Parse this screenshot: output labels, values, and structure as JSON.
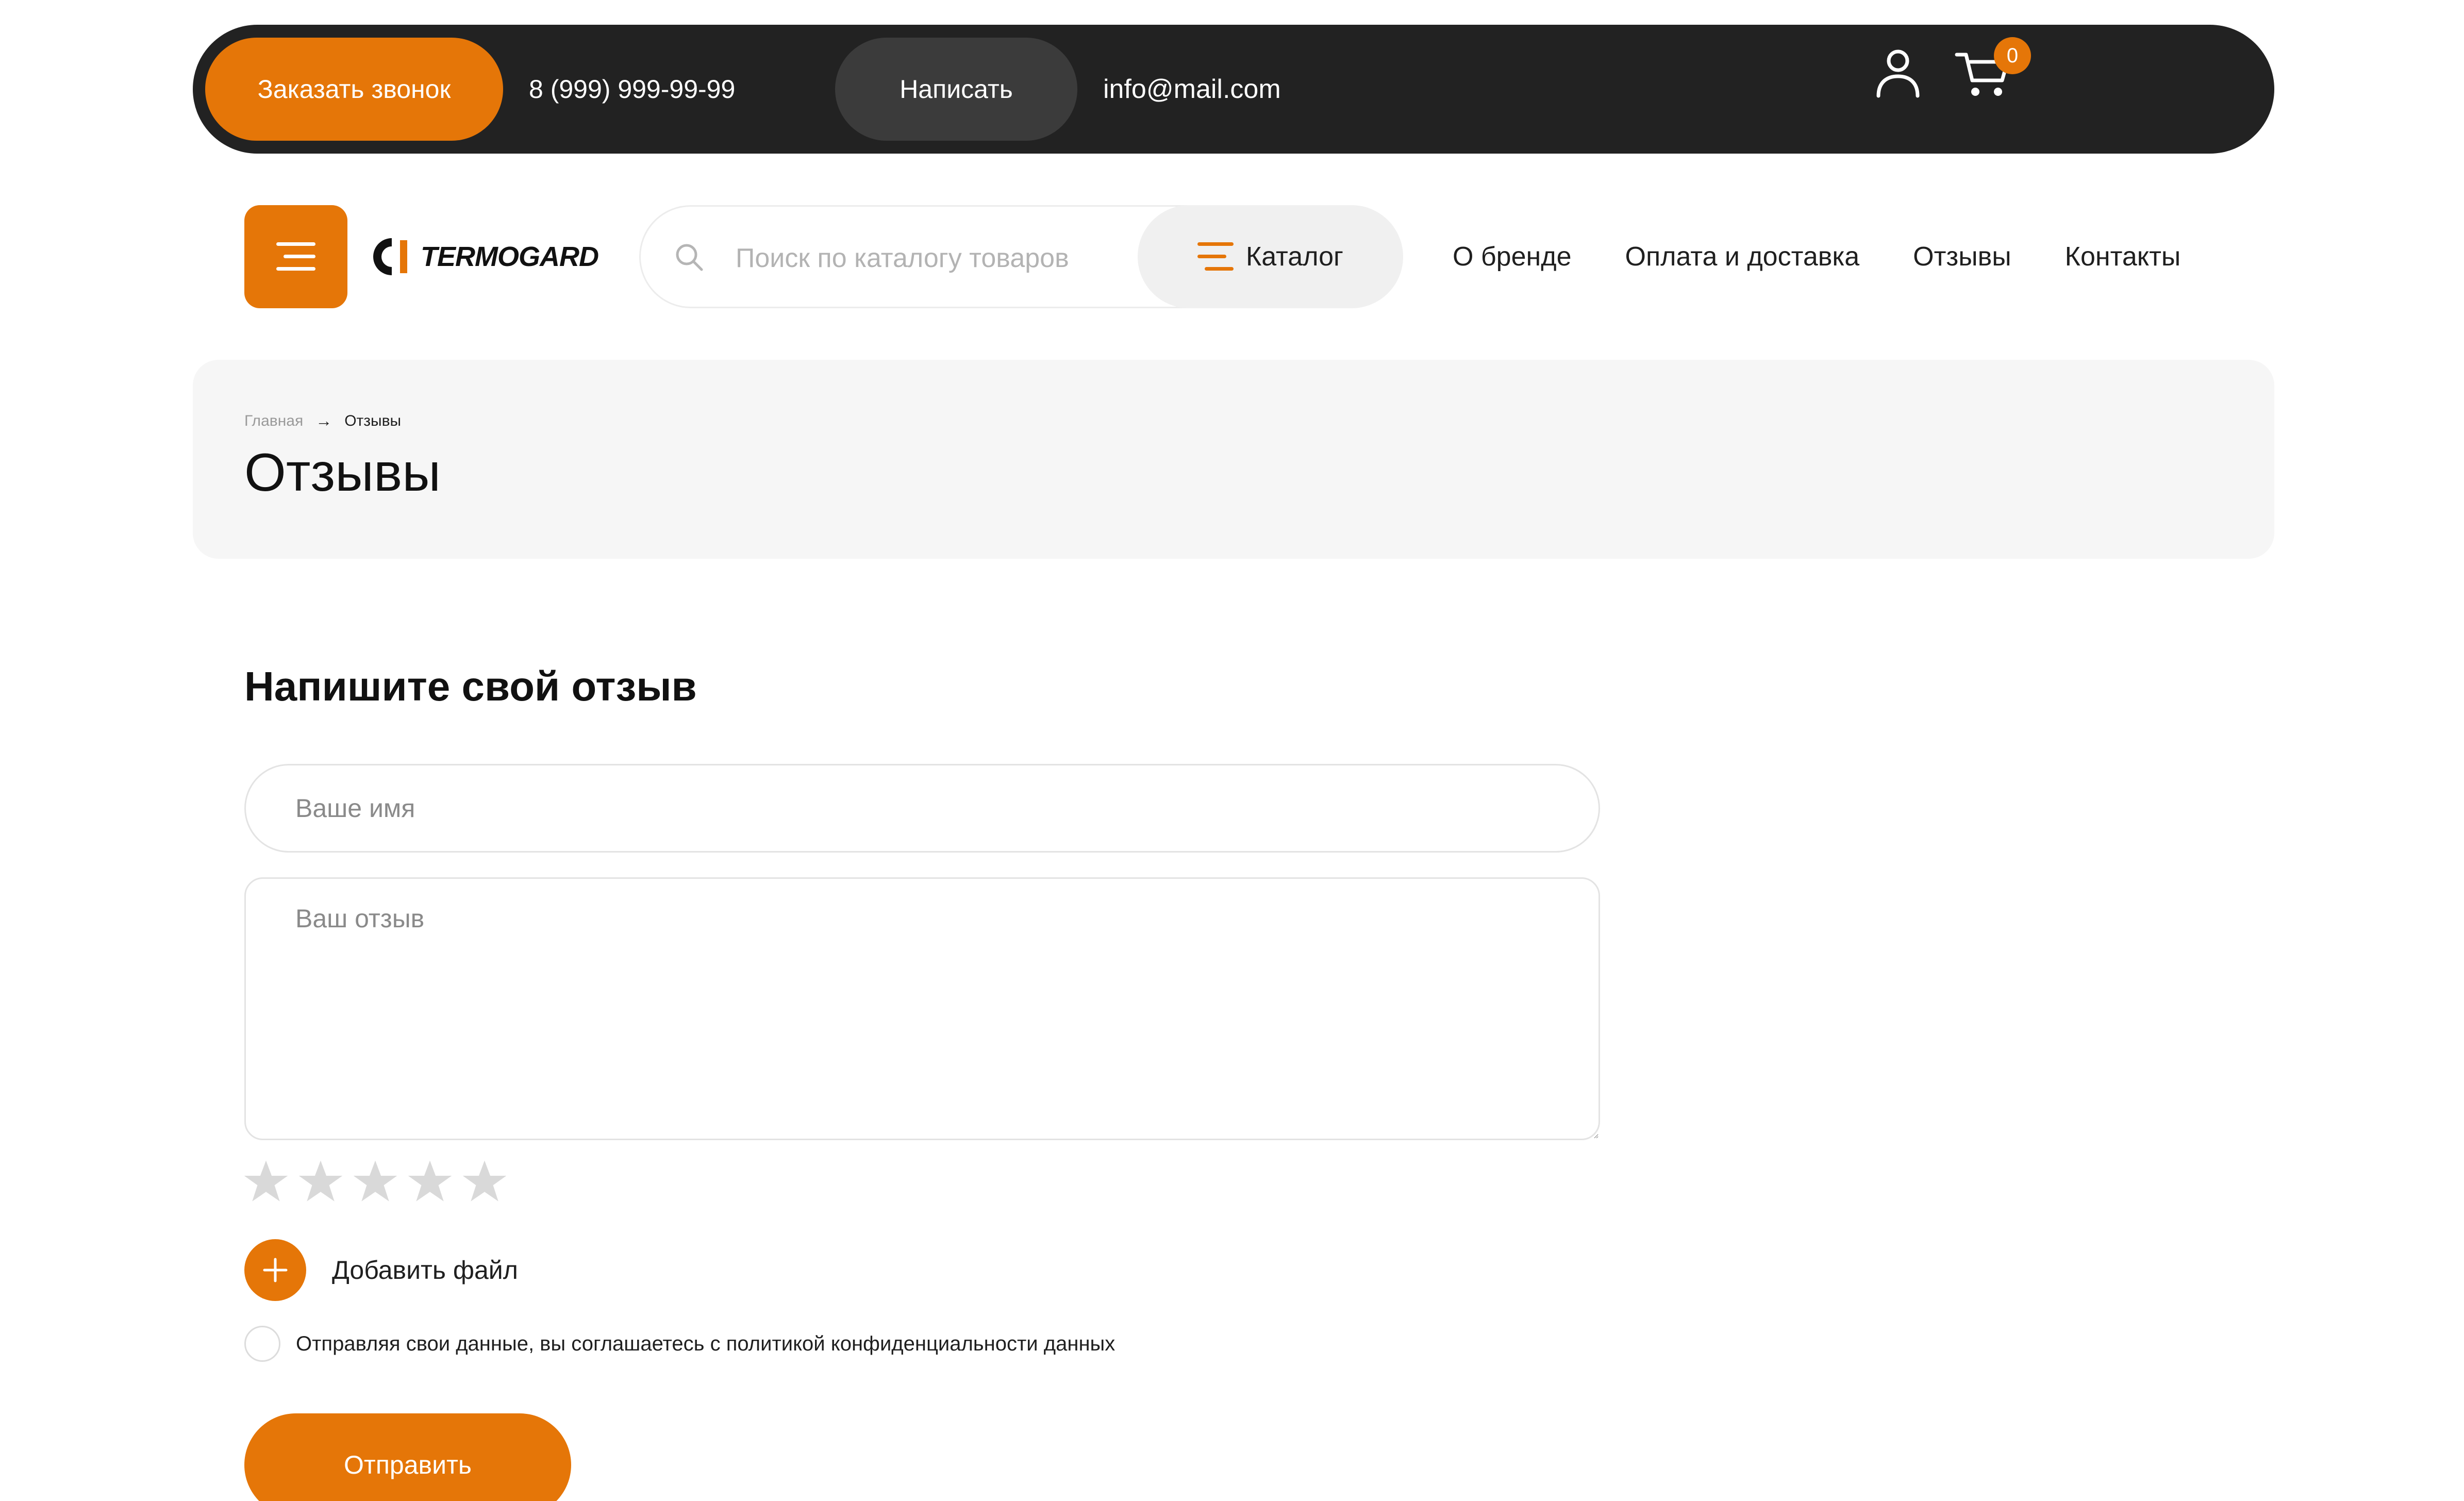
{
  "topbar": {
    "call_button": "Заказать звонок",
    "phone": "8 (999) 999-99-99",
    "write_button": "Написать",
    "email": "info@mail.com",
    "cart_count": "0"
  },
  "header": {
    "logo_text": "TERMOGARD",
    "search_placeholder": "Поиск по каталогу товаров",
    "catalog_label": "Каталог",
    "nav": [
      "О бренде",
      "Оплата и доставка",
      "Отзывы",
      "Контакты"
    ]
  },
  "breadcrumb": {
    "home": "Главная",
    "arrow": "→",
    "current": "Отзывы"
  },
  "page_title": "Отзывы",
  "form": {
    "heading": "Напишите свой отзыв",
    "name_placeholder": "Ваше имя",
    "review_placeholder": "Ваш отзыв",
    "rating": 0,
    "rating_max": 5,
    "add_file_label": "Добавить файл",
    "consent_text": "Отправляя свои данные, вы соглашаетесь с политикой конфиденциальности данных",
    "submit_label": "Отправить"
  },
  "colors": {
    "accent": "#e57608",
    "dark_bar": "#222222",
    "panel": "#f6f6f6",
    "star_inactive": "#d9d9d9"
  },
  "icons": {
    "burger": "menu-icon",
    "search": "search-icon",
    "catalog": "catalog-menu-icon",
    "user": "user-icon",
    "cart": "cart-icon",
    "star": "star-icon",
    "plus": "plus-icon"
  }
}
